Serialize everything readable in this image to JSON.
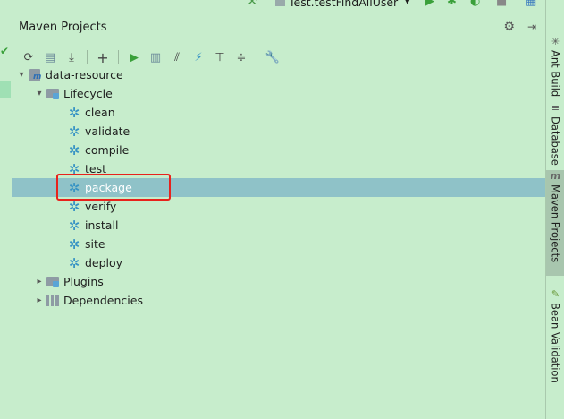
{
  "top_toolbar": {
    "run_config": "Test.testFindAllUser"
  },
  "panel": {
    "title": "Maven Projects"
  },
  "tree": {
    "project": "data-resource",
    "lifecycle_label": "Lifecycle",
    "lifecycle_items": [
      "clean",
      "validate",
      "compile",
      "test",
      "package",
      "verify",
      "install",
      "site",
      "deploy"
    ],
    "selected_item": "package",
    "plugins_label": "Plugins",
    "dependencies_label": "Dependencies"
  },
  "right_tabs": {
    "ant_build": "Ant Build",
    "database": "Database",
    "maven_projects": "Maven Projects",
    "bean_validation": "Bean Validation"
  },
  "colors": {
    "background": "#c7edcc",
    "selection": "#8fc2c8",
    "highlight_box": "#e8221c",
    "gear": "#3592c4"
  }
}
